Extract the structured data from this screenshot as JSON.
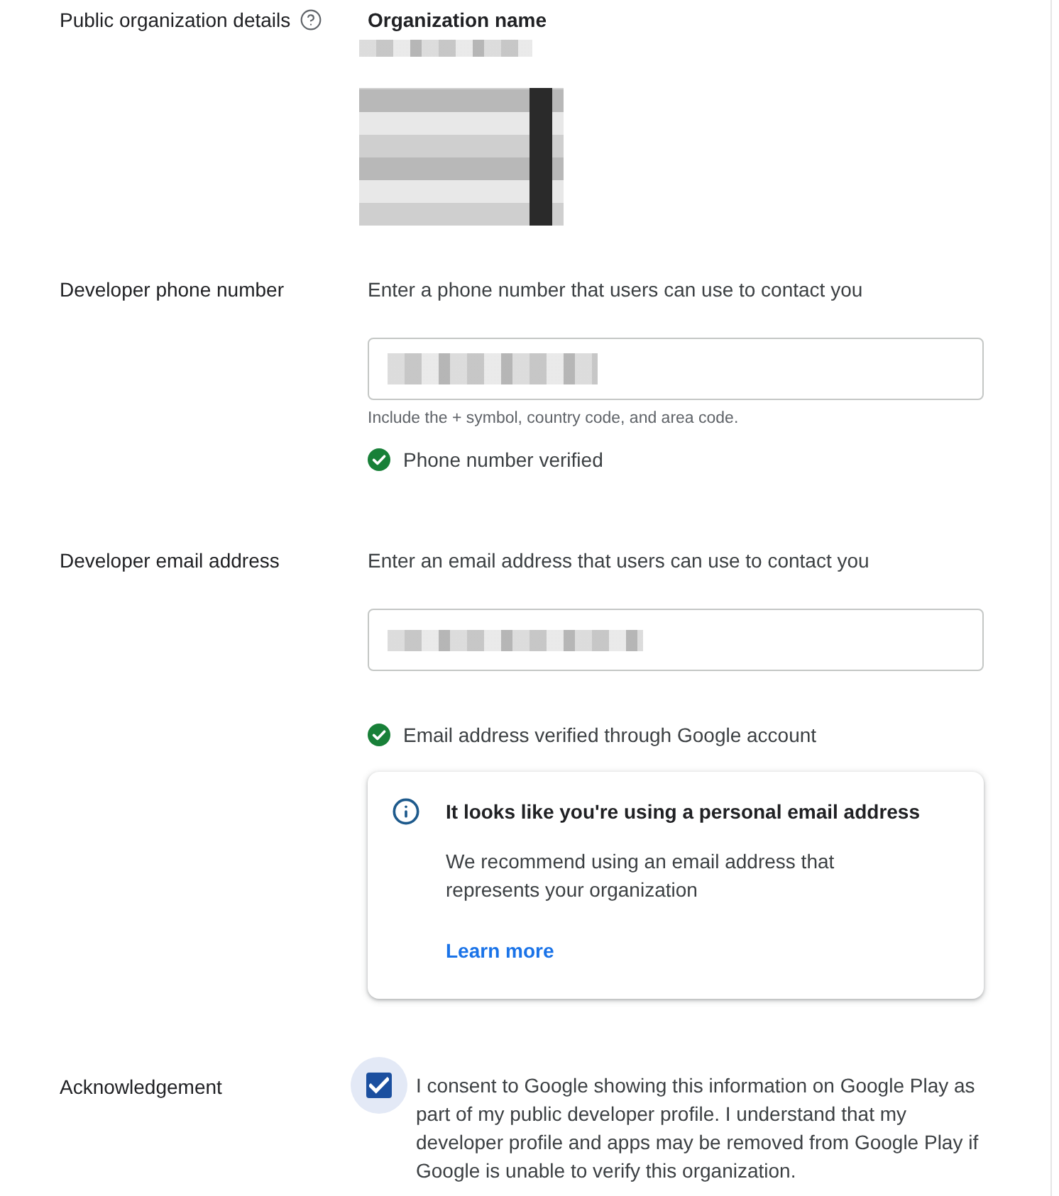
{
  "organization": {
    "label": "Public organization details",
    "name_heading": "Organization name"
  },
  "phone": {
    "label": "Developer phone number",
    "prompt": "Enter a phone number that users can use to contact you",
    "helper": "Include the + symbol, country code, and area code.",
    "status": "Phone number verified",
    "verified": true
  },
  "email": {
    "label": "Developer email address",
    "prompt": "Enter an email address that users can use to contact you",
    "status": "Email address verified through Google account",
    "verified": true,
    "notice": {
      "title": "It looks like you're using a personal email address",
      "body": "We recommend using an email address that represents your organization",
      "link": "Learn more"
    }
  },
  "acknowledgement": {
    "label": "Acknowledgement",
    "checked": true,
    "text": "I consent to Google showing this information on Google Play as part of my public developer profile. I understand that my developer profile and apps may be removed from Google Play if Google is unable to verify this organization."
  }
}
